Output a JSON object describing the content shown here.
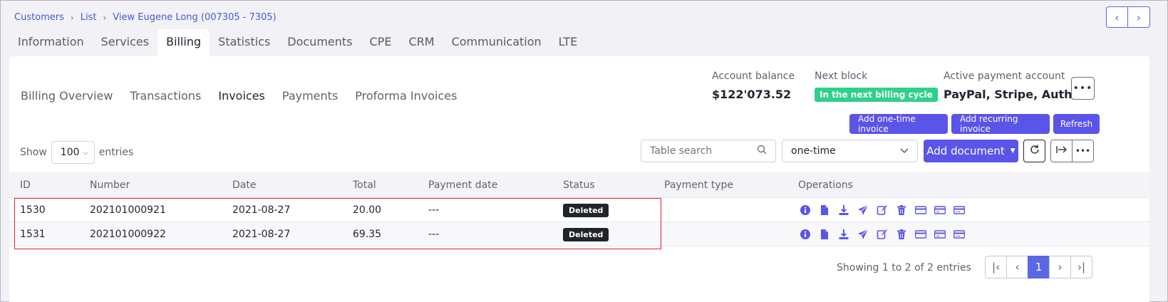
{
  "breadcrumb": [
    "Customers",
    "List",
    "View Eugene Long (007305 - 7305)"
  ],
  "main_tabs": [
    "Information",
    "Services",
    "Billing",
    "Statistics",
    "Documents",
    "CPE",
    "CRM",
    "Communication",
    "LTE"
  ],
  "sub_tabs": [
    "Billing Overview",
    "Transactions",
    "Invoices",
    "Payments",
    "Proforma Invoices"
  ],
  "account": {
    "balance_label": "Account balance",
    "balance_value": "$122'073.52",
    "next_block_label": "Next block",
    "next_block_value": "In the next billing cycle",
    "payment_label": "Active payment account",
    "payment_value": "PayPal, Stripe, Autho..."
  },
  "buttons": {
    "add_one_time": "Add one-time invoice",
    "add_recurring": "Add recurring invoice",
    "refresh": "Refresh",
    "add_document": "Add document"
  },
  "show": {
    "prefix": "Show",
    "value": "100",
    "suffix": "entries"
  },
  "search": {
    "placeholder": "Table search"
  },
  "type_filter": {
    "value": "one-time"
  },
  "table": {
    "headers": [
      "ID",
      "Number",
      "Date",
      "Total",
      "Payment date",
      "Status",
      "Payment type",
      "Operations"
    ],
    "rows": [
      {
        "id": "1530",
        "number": "202101000921",
        "date": "2021-08-27",
        "total": "20.00",
        "payment_date": "---",
        "status": "Deleted",
        "payment_type": ""
      },
      {
        "id": "1531",
        "number": "202101000922",
        "date": "2021-08-27",
        "total": "69.35",
        "payment_date": "---",
        "status": "Deleted",
        "payment_type": ""
      }
    ]
  },
  "footer": {
    "showing": "Showing 1 to 2 of 2 entries",
    "page": "1"
  },
  "colors": {
    "accent": "#5a54e8",
    "badge_green": "#2fd08a",
    "highlight": "#d8242e"
  }
}
